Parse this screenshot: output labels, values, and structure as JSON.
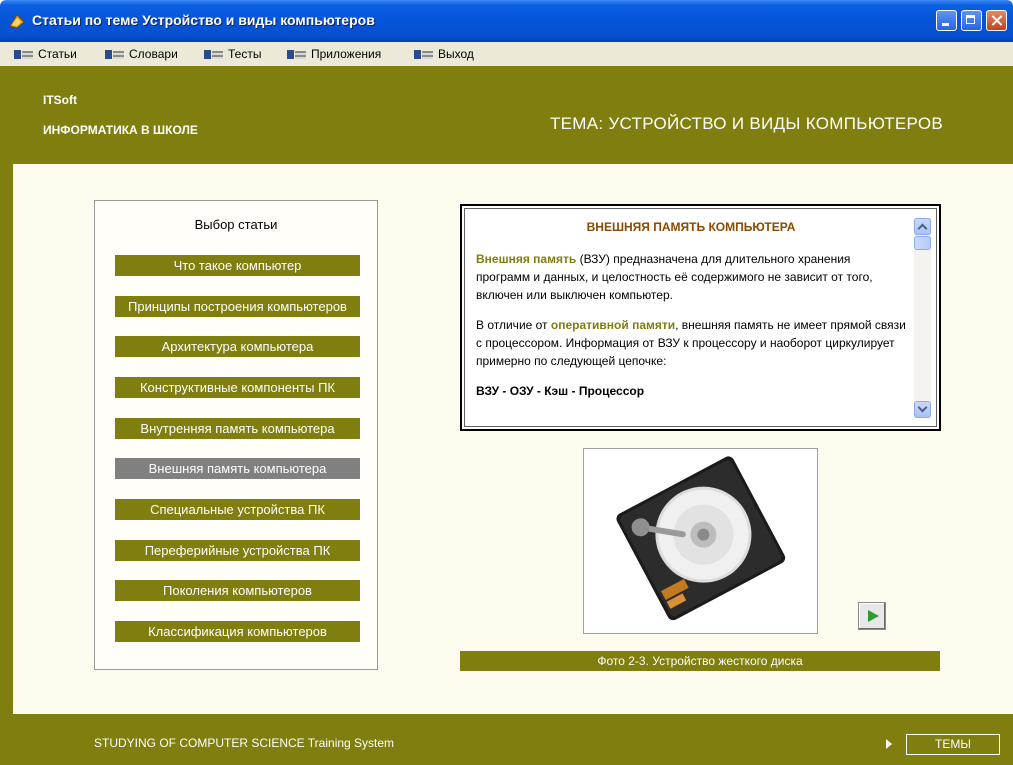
{
  "window": {
    "title": "Статьи по теме Устройство и виды компьютеров"
  },
  "menu": {
    "items": [
      "Статьи",
      "Словари",
      "Тесты",
      "Приложения",
      "Выход"
    ]
  },
  "header": {
    "brand": "ITSoft",
    "subtitle": "ИНФОРМАТИКА В ШКОЛЕ",
    "topic": "ТЕМА: УСТРОЙСТВО И ВИДЫ КОМПЬЮТЕРОВ"
  },
  "sidebar": {
    "title": "Выбор статьи",
    "active_index": 5,
    "items": [
      "Что такое компьютер",
      "Принципы построения компьютеров",
      "Архитектура компьютера",
      "Конструктивные компоненты ПК",
      "Внутренняя память компьютера",
      "Внешняя память компьютера",
      "Специальные устройства ПК",
      "Переферийные устройства ПК",
      "Поколения компьютеров",
      "Классификация компьютеров"
    ]
  },
  "article": {
    "title": "ВНЕШНЯЯ ПАМЯТЬ КОМПЬЮТЕРА",
    "p1_keyword": "Внешняя память",
    "p1_text": " (ВЗУ) предназначена для длительного хранения программ и данных, и целостность её содержимого не зависит от того, включен или выключен компьютер.",
    "p2_prefix": "В отличие от ",
    "p2_keyword": "оперативной памяти",
    "p2_text": ", внешняя память не имеет прямой связи с процессором. Информация от ВЗУ к процессору и наоборот циркулирует примерно по следующей цепочке:",
    "chain": "ВЗУ - ОЗУ - Кэш - Процессор"
  },
  "photo": {
    "caption": "Фото 2-3.  Устройство жесткого диска",
    "icon": "hard-disk-photo"
  },
  "footer": {
    "text": "STUDYING OF COMPUTER SCIENCE Training System",
    "themes_button": "ТЕМЫ"
  },
  "colors": {
    "olive": "#7f7e0f",
    "active_gray": "#808080",
    "content_bg": "#fdfbee",
    "titlebar_blue": "#0554d8"
  }
}
